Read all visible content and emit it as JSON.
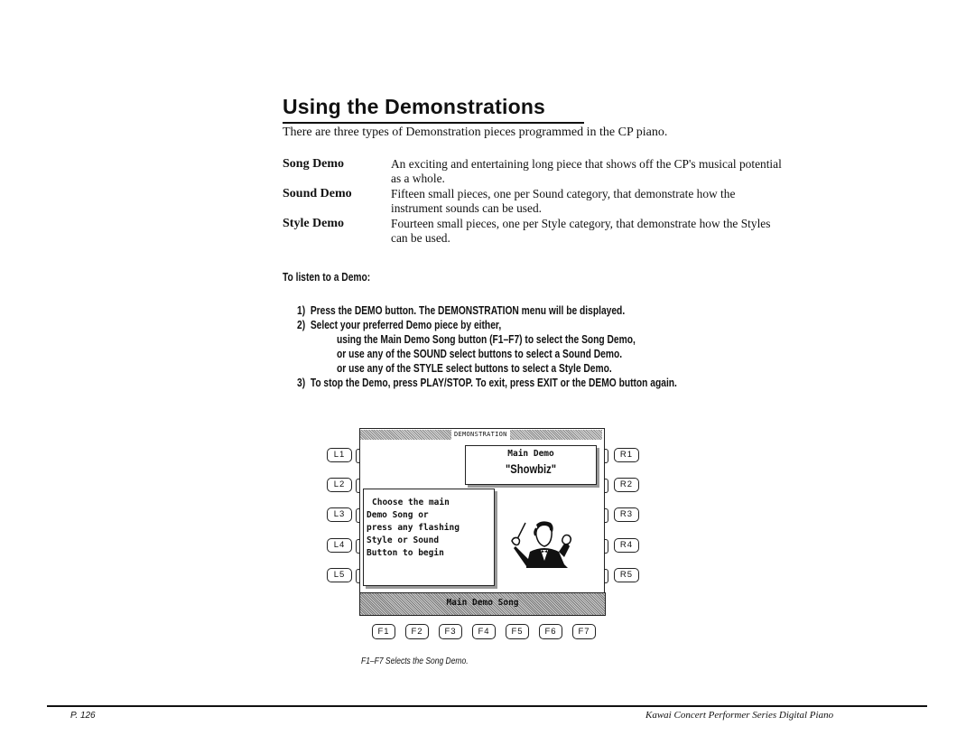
{
  "heading": "Using the Demonstrations",
  "intro": "There are three types of Demonstration pieces programmed in the CP piano.",
  "definitions": [
    {
      "term": "Song Demo",
      "lines": [
        "An exciting and entertaining long piece that shows off the CP's musical potential",
        "as a whole."
      ]
    },
    {
      "term": "Sound Demo",
      "lines": [
        "Fifteen small pieces, one per Sound category, that demonstrate how the",
        "instrument sounds can be used."
      ]
    },
    {
      "term": "Style Demo",
      "lines": [
        "Fourteen small pieces, one per Style category, that demonstrate how the Styles",
        "can be used."
      ]
    }
  ],
  "procedure": {
    "heading": "To listen to a Demo:",
    "steps": [
      {
        "num": "1)",
        "text": "Press the DEMO button.  The DEMONSTRATION menu will be displayed."
      },
      {
        "num": "2)",
        "text": "Select your preferred Demo piece by either,"
      },
      {
        "num": "",
        "text": "using the Main Demo Song button (F1–F7) to select the Song Demo,"
      },
      {
        "num": "",
        "text": "or use any of the SOUND select buttons to select a Sound Demo."
      },
      {
        "num": "",
        "text": "or use any of the STYLE select buttons to select a Style Demo."
      },
      {
        "num": "3)",
        "text": "To stop the Demo, press PLAY/STOP.  To exit, press EXIT or the DEMO button again."
      }
    ]
  },
  "display": {
    "header": "DEMONSTRATION",
    "main_demo_title": "Main Demo",
    "main_demo_song": "\"Showbiz\"",
    "message_lines": [
      "Choose the main",
      "Demo Song or",
      "press any flashing",
      "Style or Sound",
      "Button to begin"
    ],
    "bottom_label": "Main Demo Song",
    "illustration": "conductor-icon",
    "left_buttons": [
      "L1",
      "L2",
      "L3",
      "L4",
      "L5"
    ],
    "right_buttons": [
      "R1",
      "R2",
      "R3",
      "R4",
      "R5"
    ],
    "function_buttons": [
      "F1",
      "F2",
      "F3",
      "F4",
      "F5",
      "F6",
      "F7"
    ]
  },
  "caption": "F1–F7  Selects the Song Demo.",
  "footer": {
    "page": "P. 126",
    "title": "Kawai Concert Performer Series Digital Piano"
  }
}
